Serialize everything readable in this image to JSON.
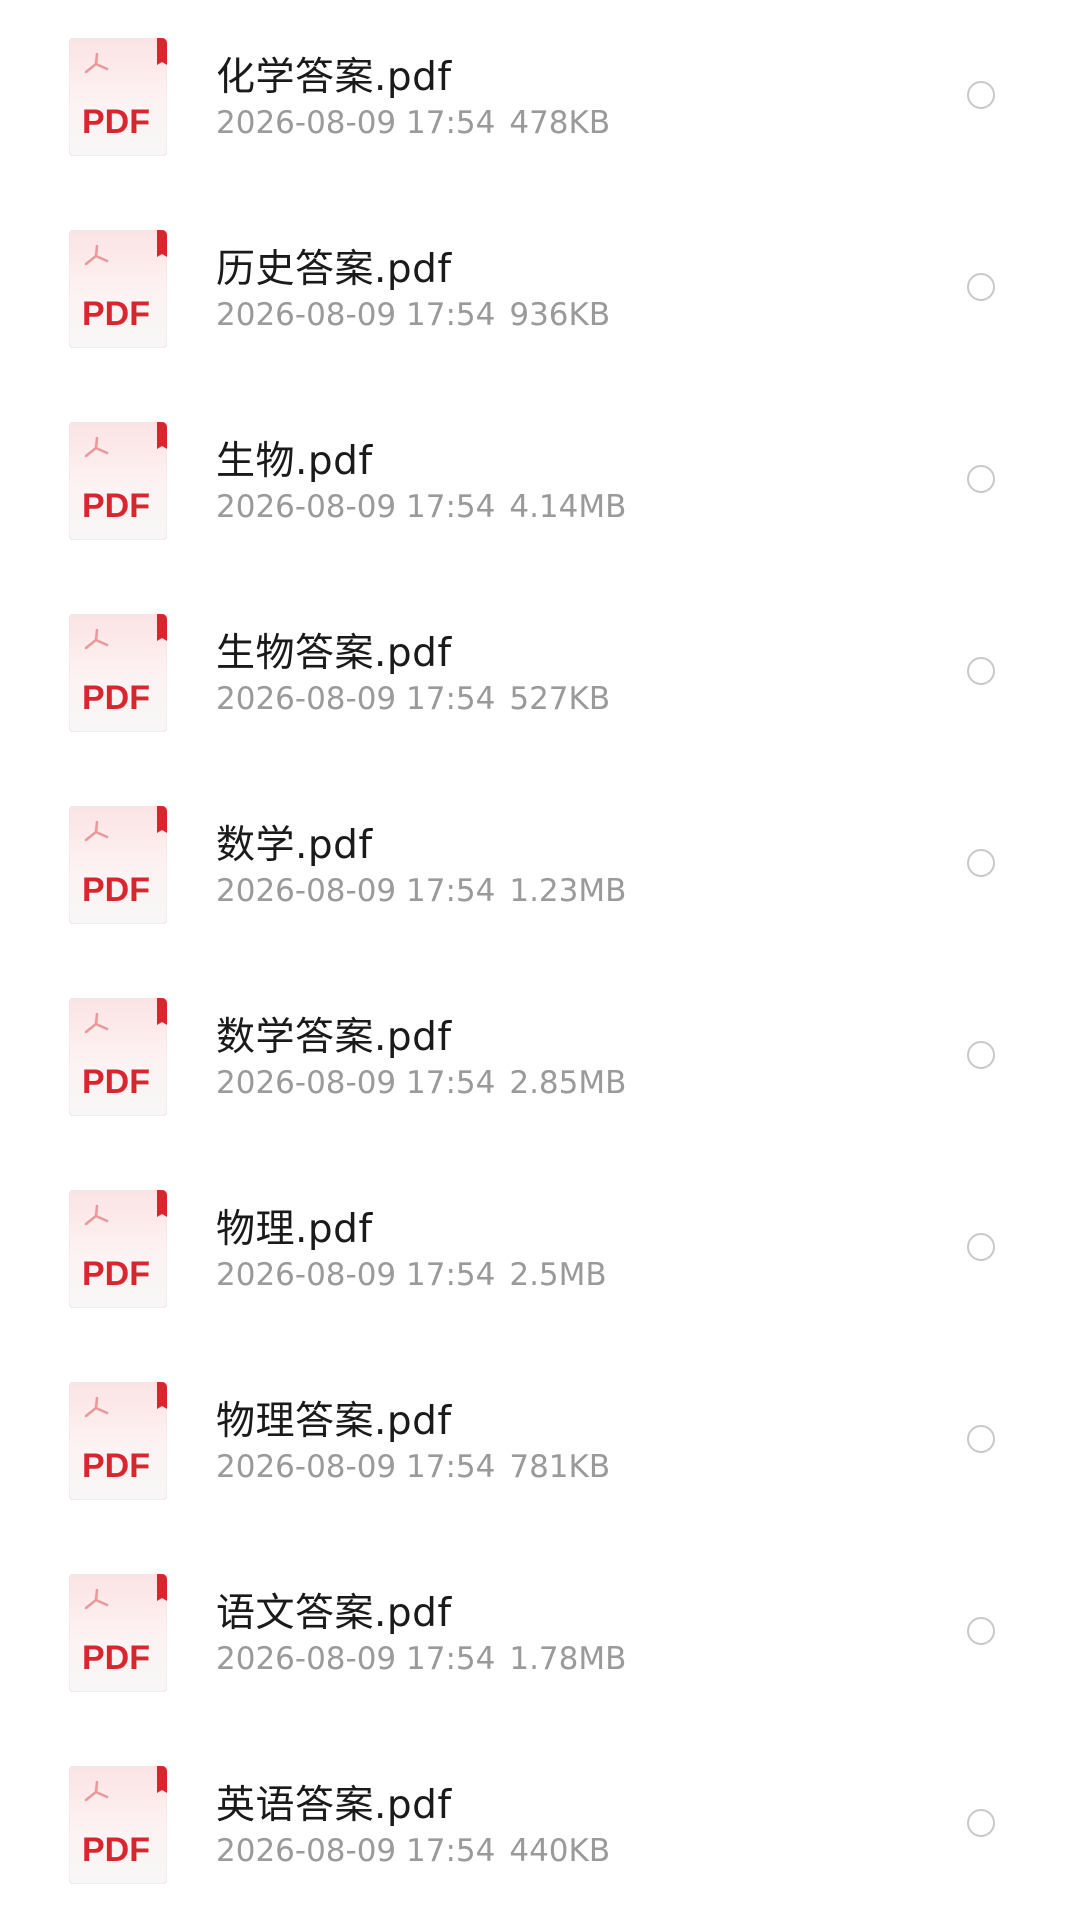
{
  "files": [
    {
      "name": "化学答案.pdf",
      "date": "2026-08-09 17:54",
      "size": "478KB",
      "icon": "pdf-file-icon",
      "badge": "PDF"
    },
    {
      "name": "历史答案.pdf",
      "date": "2026-08-09 17:54",
      "size": "936KB",
      "icon": "pdf-file-icon",
      "badge": "PDF"
    },
    {
      "name": "生物.pdf",
      "date": "2026-08-09 17:54",
      "size": "4.14MB",
      "icon": "pdf-file-icon",
      "badge": "PDF"
    },
    {
      "name": "生物答案.pdf",
      "date": "2026-08-09 17:54",
      "size": "527KB",
      "icon": "pdf-file-icon",
      "badge": "PDF"
    },
    {
      "name": "数学.pdf",
      "date": "2026-08-09 17:54",
      "size": "1.23MB",
      "icon": "pdf-file-icon",
      "badge": "PDF"
    },
    {
      "name": "数学答案.pdf",
      "date": "2026-08-09 17:54",
      "size": "2.85MB",
      "icon": "pdf-file-icon",
      "badge": "PDF"
    },
    {
      "name": "物理.pdf",
      "date": "2026-08-09 17:54",
      "size": "2.5MB",
      "icon": "pdf-file-icon",
      "badge": "PDF"
    },
    {
      "name": "物理答案.pdf",
      "date": "2026-08-09 17:54",
      "size": "781KB",
      "icon": "pdf-file-icon",
      "badge": "PDF"
    },
    {
      "name": "语文答案.pdf",
      "date": "2026-08-09 17:54",
      "size": "1.78MB",
      "icon": "pdf-file-icon",
      "badge": "PDF"
    },
    {
      "name": "英语答案.pdf",
      "date": "2026-08-09 17:54",
      "size": "440KB",
      "icon": "pdf-file-icon",
      "badge": "PDF"
    }
  ],
  "colors": {
    "pdf_red": "#d8262e",
    "pdf_bg_top": "#fbe3e4",
    "pdf_bg_bottom": "#f7f7f7",
    "title_text": "#1a1a1a",
    "meta_text": "#9a9a9a",
    "radio_border": "#c9c9c9"
  }
}
